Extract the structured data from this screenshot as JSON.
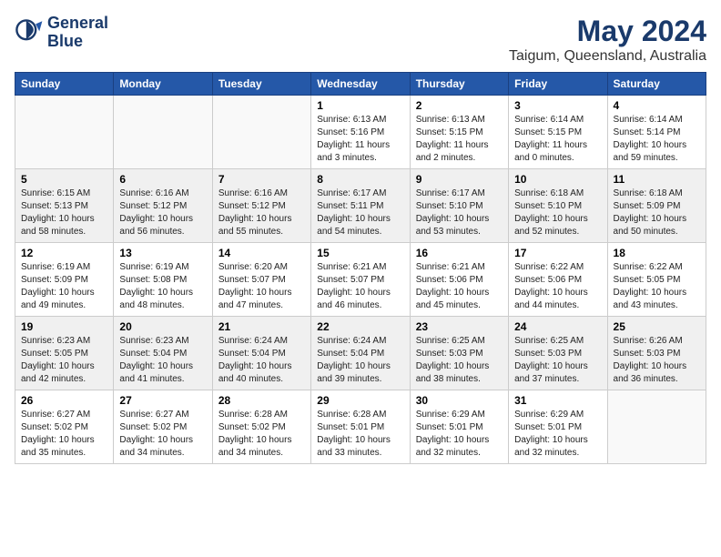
{
  "header": {
    "logo_line1": "General",
    "logo_line2": "Blue",
    "month": "May 2024",
    "location": "Taigum, Queensland, Australia"
  },
  "weekdays": [
    "Sunday",
    "Monday",
    "Tuesday",
    "Wednesday",
    "Thursday",
    "Friday",
    "Saturday"
  ],
  "weeks": [
    [
      {
        "day": "",
        "info": ""
      },
      {
        "day": "",
        "info": ""
      },
      {
        "day": "",
        "info": ""
      },
      {
        "day": "1",
        "info": "Sunrise: 6:13 AM\nSunset: 5:16 PM\nDaylight: 11 hours and 3 minutes."
      },
      {
        "day": "2",
        "info": "Sunrise: 6:13 AM\nSunset: 5:15 PM\nDaylight: 11 hours and 2 minutes."
      },
      {
        "day": "3",
        "info": "Sunrise: 6:14 AM\nSunset: 5:15 PM\nDaylight: 11 hours and 0 minutes."
      },
      {
        "day": "4",
        "info": "Sunrise: 6:14 AM\nSunset: 5:14 PM\nDaylight: 10 hours and 59 minutes."
      }
    ],
    [
      {
        "day": "5",
        "info": "Sunrise: 6:15 AM\nSunset: 5:13 PM\nDaylight: 10 hours and 58 minutes."
      },
      {
        "day": "6",
        "info": "Sunrise: 6:16 AM\nSunset: 5:12 PM\nDaylight: 10 hours and 56 minutes."
      },
      {
        "day": "7",
        "info": "Sunrise: 6:16 AM\nSunset: 5:12 PM\nDaylight: 10 hours and 55 minutes."
      },
      {
        "day": "8",
        "info": "Sunrise: 6:17 AM\nSunset: 5:11 PM\nDaylight: 10 hours and 54 minutes."
      },
      {
        "day": "9",
        "info": "Sunrise: 6:17 AM\nSunset: 5:10 PM\nDaylight: 10 hours and 53 minutes."
      },
      {
        "day": "10",
        "info": "Sunrise: 6:18 AM\nSunset: 5:10 PM\nDaylight: 10 hours and 52 minutes."
      },
      {
        "day": "11",
        "info": "Sunrise: 6:18 AM\nSunset: 5:09 PM\nDaylight: 10 hours and 50 minutes."
      }
    ],
    [
      {
        "day": "12",
        "info": "Sunrise: 6:19 AM\nSunset: 5:09 PM\nDaylight: 10 hours and 49 minutes."
      },
      {
        "day": "13",
        "info": "Sunrise: 6:19 AM\nSunset: 5:08 PM\nDaylight: 10 hours and 48 minutes."
      },
      {
        "day": "14",
        "info": "Sunrise: 6:20 AM\nSunset: 5:07 PM\nDaylight: 10 hours and 47 minutes."
      },
      {
        "day": "15",
        "info": "Sunrise: 6:21 AM\nSunset: 5:07 PM\nDaylight: 10 hours and 46 minutes."
      },
      {
        "day": "16",
        "info": "Sunrise: 6:21 AM\nSunset: 5:06 PM\nDaylight: 10 hours and 45 minutes."
      },
      {
        "day": "17",
        "info": "Sunrise: 6:22 AM\nSunset: 5:06 PM\nDaylight: 10 hours and 44 minutes."
      },
      {
        "day": "18",
        "info": "Sunrise: 6:22 AM\nSunset: 5:05 PM\nDaylight: 10 hours and 43 minutes."
      }
    ],
    [
      {
        "day": "19",
        "info": "Sunrise: 6:23 AM\nSunset: 5:05 PM\nDaylight: 10 hours and 42 minutes."
      },
      {
        "day": "20",
        "info": "Sunrise: 6:23 AM\nSunset: 5:04 PM\nDaylight: 10 hours and 41 minutes."
      },
      {
        "day": "21",
        "info": "Sunrise: 6:24 AM\nSunset: 5:04 PM\nDaylight: 10 hours and 40 minutes."
      },
      {
        "day": "22",
        "info": "Sunrise: 6:24 AM\nSunset: 5:04 PM\nDaylight: 10 hours and 39 minutes."
      },
      {
        "day": "23",
        "info": "Sunrise: 6:25 AM\nSunset: 5:03 PM\nDaylight: 10 hours and 38 minutes."
      },
      {
        "day": "24",
        "info": "Sunrise: 6:25 AM\nSunset: 5:03 PM\nDaylight: 10 hours and 37 minutes."
      },
      {
        "day": "25",
        "info": "Sunrise: 6:26 AM\nSunset: 5:03 PM\nDaylight: 10 hours and 36 minutes."
      }
    ],
    [
      {
        "day": "26",
        "info": "Sunrise: 6:27 AM\nSunset: 5:02 PM\nDaylight: 10 hours and 35 minutes."
      },
      {
        "day": "27",
        "info": "Sunrise: 6:27 AM\nSunset: 5:02 PM\nDaylight: 10 hours and 34 minutes."
      },
      {
        "day": "28",
        "info": "Sunrise: 6:28 AM\nSunset: 5:02 PM\nDaylight: 10 hours and 34 minutes."
      },
      {
        "day": "29",
        "info": "Sunrise: 6:28 AM\nSunset: 5:01 PM\nDaylight: 10 hours and 33 minutes."
      },
      {
        "day": "30",
        "info": "Sunrise: 6:29 AM\nSunset: 5:01 PM\nDaylight: 10 hours and 32 minutes."
      },
      {
        "day": "31",
        "info": "Sunrise: 6:29 AM\nSunset: 5:01 PM\nDaylight: 10 hours and 32 minutes."
      },
      {
        "day": "",
        "info": ""
      }
    ]
  ]
}
